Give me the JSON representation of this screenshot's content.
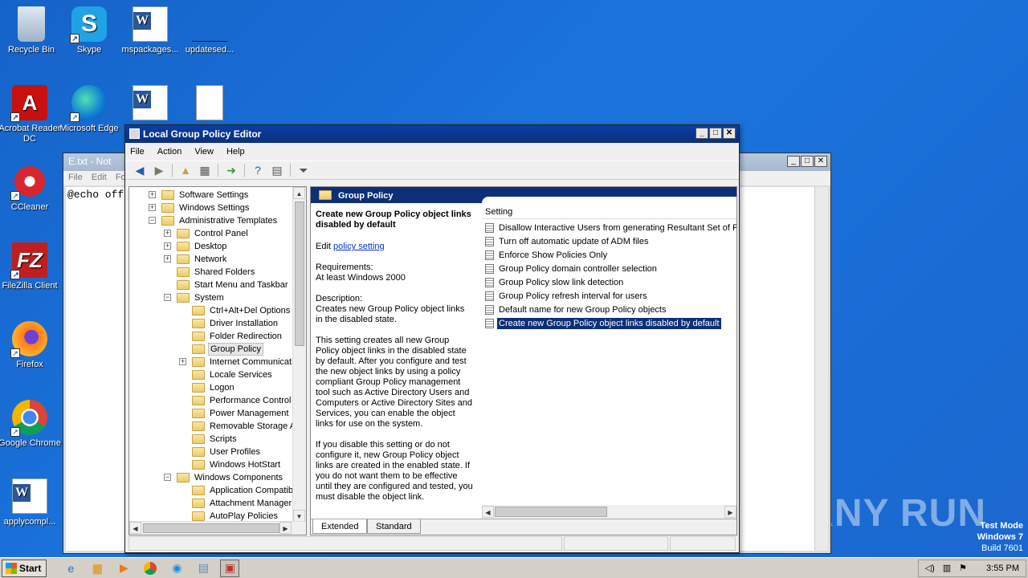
{
  "desktop": {
    "icons": [
      {
        "label": "Recycle Bin",
        "icon": "recycle-bin-icon"
      },
      {
        "label": "Skype",
        "icon": "skype-icon"
      },
      {
        "label": "mspackages...",
        "icon": "word-doc-icon"
      },
      {
        "label": "updatesed...",
        "icon": "blank-file-icon"
      },
      {
        "label": "Acrobat Reader DC",
        "icon": "acrobat-icon"
      },
      {
        "label": "Microsoft Edge",
        "icon": "edge-icon"
      },
      {
        "label": "CCleaner",
        "icon": "ccleaner-icon"
      },
      {
        "label": "FileZilla Client",
        "icon": "filezilla-icon"
      },
      {
        "label": "Firefox",
        "icon": "firefox-icon"
      },
      {
        "label": "Google Chrome",
        "icon": "chrome-icon"
      },
      {
        "label": "applycompl...",
        "icon": "word-doc-icon"
      }
    ],
    "watermark": "ANY RUN",
    "test_mode": {
      "line1": "Test Mode",
      "line2": "Windows 7",
      "line3": "Build 7601"
    }
  },
  "notepad": {
    "title": "E.txt - Not",
    "menu": [
      "File",
      "Edit",
      "Fo"
    ],
    "content": "@echo off"
  },
  "gpe": {
    "title": "Local Group Policy Editor",
    "menu": [
      "File",
      "Action",
      "View",
      "Help"
    ],
    "tree": [
      {
        "label": "Software Settings",
        "expander": "+"
      },
      {
        "label": "Windows Settings",
        "expander": "+"
      },
      {
        "label": "Administrative Templates",
        "expander": "−"
      },
      {
        "label": "Control Panel",
        "expander": "+"
      },
      {
        "label": "Desktop",
        "expander": "+"
      },
      {
        "label": "Network",
        "expander": "+"
      },
      {
        "label": "Shared Folders",
        "expander": ""
      },
      {
        "label": "Start Menu and Taskbar",
        "expander": ""
      },
      {
        "label": "System",
        "expander": "−"
      },
      {
        "label": "Ctrl+Alt+Del Options",
        "expander": ""
      },
      {
        "label": "Driver Installation",
        "expander": ""
      },
      {
        "label": "Folder Redirection",
        "expander": ""
      },
      {
        "label": "Group Policy",
        "expander": ""
      },
      {
        "label": "Internet Communicati",
        "expander": "+"
      },
      {
        "label": "Locale Services",
        "expander": ""
      },
      {
        "label": "Logon",
        "expander": ""
      },
      {
        "label": "Performance Control I",
        "expander": ""
      },
      {
        "label": "Power Management",
        "expander": ""
      },
      {
        "label": "Removable Storage A",
        "expander": ""
      },
      {
        "label": "Scripts",
        "expander": ""
      },
      {
        "label": "User Profiles",
        "expander": ""
      },
      {
        "label": "Windows HotStart",
        "expander": ""
      },
      {
        "label": "Windows Components",
        "expander": "−"
      },
      {
        "label": "Application Compatibil",
        "expander": ""
      },
      {
        "label": "Attachment Manager",
        "expander": ""
      },
      {
        "label": "AutoPlay Policies",
        "expander": ""
      }
    ],
    "pane_header": "Group Policy",
    "description": {
      "title": "Create new Group Policy object links disabled by default",
      "edit_prefix": "Edit",
      "edit_link": "policy setting",
      "requirements_label": "Requirements:",
      "requirements": "At least Windows 2000",
      "description_label": "Description:",
      "summary": "Creates new Group Policy object links in the disabled state.",
      "para1": "This setting creates all new Group Policy object links in the disabled state by default. After you configure and test the new object links by using a policy compliant Group Policy management tool such as  Active Directory Users and Computers or Active Directory Sites and Services, you can enable the object links for use on the system.",
      "para2": "If you disable this setting or do not configure it, new Group Policy object links are created in the enabled state. If you do not want them to be effective until they are configured and tested, you must disable the object link."
    },
    "list_header": "Setting",
    "settings": [
      "Disallow Interactive Users from generating Resultant Set of Po",
      "Turn off automatic update of ADM files",
      "Enforce Show Policies Only",
      "Group Policy domain controller selection",
      "Group Policy slow link detection",
      "Group Policy refresh interval for users",
      "Default name for new Group Policy objects",
      "Create new Group Policy object links disabled by default"
    ],
    "tabs": [
      "Extended",
      "Standard"
    ]
  },
  "taskbar": {
    "start": "Start",
    "clock": "3:55 PM",
    "items": [
      "ie-icon",
      "explorer-icon",
      "media-player-icon",
      "chrome-icon",
      "edge-icon",
      "notepad-icon",
      "gpedit-icon"
    ]
  }
}
